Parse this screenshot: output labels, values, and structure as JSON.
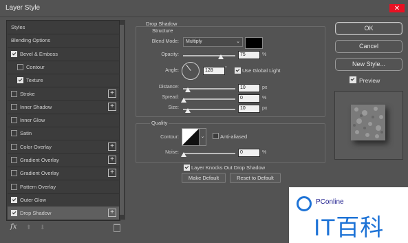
{
  "window": {
    "title": "Layer Style",
    "close": "✕"
  },
  "left_list": [
    {
      "label": "Styles",
      "checkbox": false,
      "plus": false,
      "indent": 0
    },
    {
      "label": "Blending Options",
      "checkbox": false,
      "plus": false,
      "indent": 0
    },
    {
      "label": "Bevel & Emboss",
      "checkbox": true,
      "checked": true,
      "plus": false,
      "indent": 0
    },
    {
      "label": "Contour",
      "checkbox": true,
      "checked": false,
      "plus": false,
      "indent": 1
    },
    {
      "label": "Texture",
      "checkbox": true,
      "checked": true,
      "plus": false,
      "indent": 1
    },
    {
      "label": "Stroke",
      "checkbox": true,
      "checked": false,
      "plus": true,
      "indent": 0
    },
    {
      "label": "Inner Shadow",
      "checkbox": true,
      "checked": false,
      "plus": true,
      "indent": 0
    },
    {
      "label": "Inner Glow",
      "checkbox": true,
      "checked": false,
      "plus": false,
      "indent": 0
    },
    {
      "label": "Satin",
      "checkbox": true,
      "checked": false,
      "plus": false,
      "indent": 0
    },
    {
      "label": "Color Overlay",
      "checkbox": true,
      "checked": false,
      "plus": true,
      "indent": 0
    },
    {
      "label": "Gradient Overlay",
      "checkbox": true,
      "checked": false,
      "plus": true,
      "indent": 0
    },
    {
      "label": "Gradient Overlay",
      "checkbox": true,
      "checked": false,
      "plus": true,
      "indent": 0
    },
    {
      "label": "Pattern Overlay",
      "checkbox": true,
      "checked": false,
      "plus": false,
      "indent": 0
    },
    {
      "label": "Outer Glow",
      "checkbox": true,
      "checked": true,
      "plus": false,
      "indent": 0
    },
    {
      "label": "Drop Shadow",
      "checkbox": true,
      "checked": true,
      "plus": true,
      "indent": 0,
      "selected": true
    }
  ],
  "bottom_bar": {
    "fx": "fx",
    "up": "⬆",
    "down": "⬇"
  },
  "drop_shadow": {
    "header": "Drop Shadow",
    "structure": "Structure",
    "blend_mode_label": "Blend Mode:",
    "blend_mode": "Multiply",
    "opacity_label": "Opacity:",
    "opacity": "75",
    "opacity_value": 0.75,
    "angle_label": "Angle:",
    "angle": "128",
    "angle_deg_sym": "°",
    "use_global_light": "Use Global Light",
    "distance_label": "Distance:",
    "distance": "10",
    "spread_label": "Spread:",
    "spread": "0",
    "size_label": "Size:",
    "size": "10",
    "unit_percent": "%",
    "unit_px": "px",
    "quality": "Quality",
    "contour_label": "Contour:",
    "anti_aliased": "Anti-aliased",
    "noise_label": "Noise:",
    "noise": "0",
    "layer_knocks_out": "Layer Knocks Out Drop Shadow",
    "make_default": "Make Default",
    "reset_default": "Reset to Default"
  },
  "right": {
    "ok": "OK",
    "cancel": "Cancel",
    "new_style": "New Style...",
    "preview": "Preview"
  },
  "watermark": {
    "brand": "PConline",
    "mark": "IT百科"
  },
  "colors": {
    "bg": "#535353",
    "shadow_color": "#000000",
    "watermark_blue": "#1e73d6"
  }
}
